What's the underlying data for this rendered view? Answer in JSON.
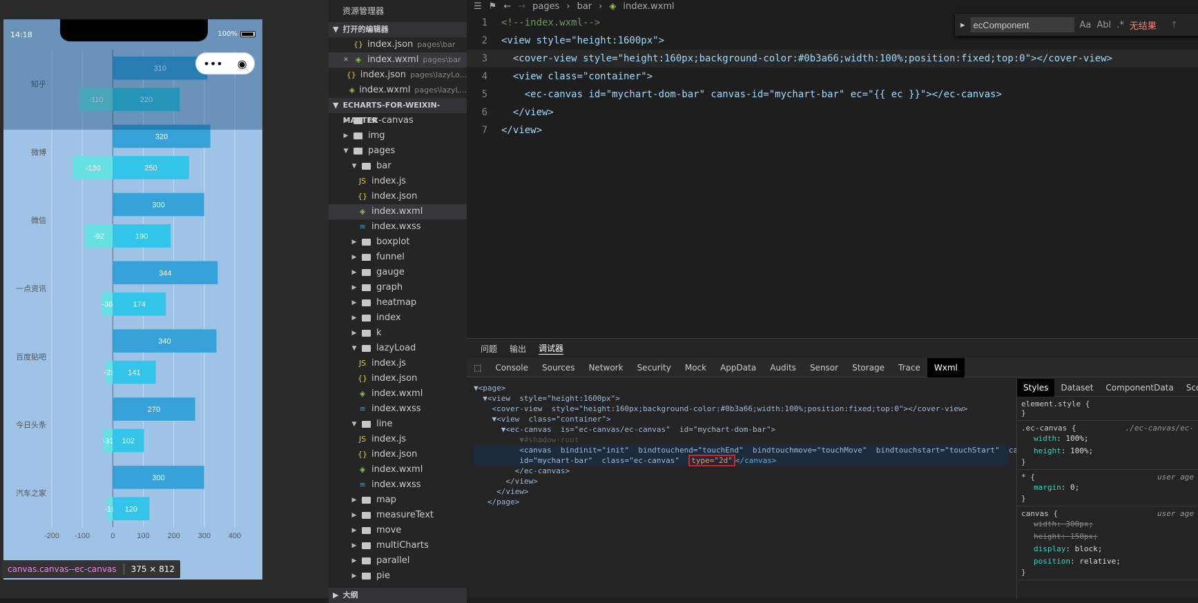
{
  "simulator": {
    "time": "14:18",
    "battery": "100%",
    "capsule_more": "•••",
    "capsule_close": "◉",
    "element_tag": "canvas.canvas--ec-canvas",
    "element_size": "375 × 812"
  },
  "chart_data": {
    "type": "bar",
    "orientation": "horizontal",
    "categories": [
      "知乎",
      "微博",
      "微信",
      "一点资讯",
      "百度贴吧",
      "今日头条",
      "汽车之家"
    ],
    "series": [
      {
        "values": [
          310,
          320,
          300,
          344,
          340,
          270,
          300
        ],
        "color": "#37a2da",
        "labels_shown": true
      },
      {
        "values": [
          220,
          250,
          190,
          174,
          141,
          102,
          120
        ],
        "color": "#32c5e9",
        "labels_shown": true
      },
      {
        "values": [
          -110,
          -130,
          -92,
          -36,
          -23,
          -31,
          -19
        ],
        "color": "#67e0e3",
        "labels_shown": true
      }
    ],
    "xlim": [
      -200,
      400
    ],
    "xticks": [
      "-200",
      "-100",
      "0",
      "100",
      "200",
      "300",
      "400"
    ],
    "grid": true,
    "background": "#9fc3e7"
  },
  "explorer": {
    "title": "资源管理器",
    "open_editors_label": "打开的编辑器",
    "open_editors": [
      {
        "name": "index.json",
        "path": "pages\\bar",
        "type": "json"
      },
      {
        "name": "index.wxml",
        "path": "pages\\bar",
        "type": "wxml",
        "close": "✕"
      },
      {
        "name": "index.json",
        "path": "pages\\lazyLo...",
        "type": "json"
      },
      {
        "name": "index.wxml",
        "path": "pages\\lazyL...",
        "type": "wxml"
      }
    ],
    "project_label": "ECHARTS-FOR-WEIXIN-MASTER",
    "tree": [
      {
        "name": "ec-canvas",
        "kind": "folder",
        "depth": 1
      },
      {
        "name": "img",
        "kind": "folder",
        "depth": 1
      },
      {
        "name": "pages",
        "kind": "folder",
        "depth": 1,
        "open": true
      },
      {
        "name": "bar",
        "kind": "folder",
        "depth": 2,
        "open": true
      },
      {
        "name": "index.js",
        "kind": "js",
        "depth": 3
      },
      {
        "name": "index.json",
        "kind": "json",
        "depth": 3
      },
      {
        "name": "index.wxml",
        "kind": "wxml",
        "depth": 3,
        "selected": true
      },
      {
        "name": "index.wxss",
        "kind": "wxss",
        "depth": 3
      },
      {
        "name": "boxplot",
        "kind": "folder",
        "depth": 2
      },
      {
        "name": "funnel",
        "kind": "folder",
        "depth": 2
      },
      {
        "name": "gauge",
        "kind": "folder",
        "depth": 2
      },
      {
        "name": "graph",
        "kind": "folder",
        "depth": 2
      },
      {
        "name": "heatmap",
        "kind": "folder",
        "depth": 2
      },
      {
        "name": "index",
        "kind": "folder",
        "depth": 2
      },
      {
        "name": "k",
        "kind": "folder",
        "depth": 2
      },
      {
        "name": "lazyLoad",
        "kind": "folder",
        "depth": 2,
        "open": true
      },
      {
        "name": "index.js",
        "kind": "js",
        "depth": 3
      },
      {
        "name": "index.json",
        "kind": "json",
        "depth": 3
      },
      {
        "name": "index.wxml",
        "kind": "wxml",
        "depth": 3
      },
      {
        "name": "index.wxss",
        "kind": "wxss",
        "depth": 3
      },
      {
        "name": "line",
        "kind": "folder",
        "depth": 2,
        "open": true
      },
      {
        "name": "index.js",
        "kind": "js",
        "depth": 3
      },
      {
        "name": "index.json",
        "kind": "json",
        "depth": 3
      },
      {
        "name": "index.wxml",
        "kind": "wxml",
        "depth": 3
      },
      {
        "name": "index.wxss",
        "kind": "wxss",
        "depth": 3
      },
      {
        "name": "map",
        "kind": "folder",
        "depth": 2
      },
      {
        "name": "measureText",
        "kind": "folder",
        "depth": 2
      },
      {
        "name": "move",
        "kind": "folder",
        "depth": 2
      },
      {
        "name": "multiCharts",
        "kind": "folder",
        "depth": 2
      },
      {
        "name": "parallel",
        "kind": "folder",
        "depth": 2
      },
      {
        "name": "pie",
        "kind": "folder",
        "depth": 2
      }
    ],
    "outline_label": "大纲"
  },
  "editor": {
    "breadcrumb": [
      "pages",
      "bar",
      "index.wxml"
    ],
    "find_query": "ecComponent",
    "find_no_result": "无结果",
    "find_opts": [
      "Aa",
      "Abl",
      ".*"
    ],
    "lines": [
      "<!--index.wxml-->",
      "<view style=\"height:1600px\">",
      "  <cover-view style=\"height:160px;background-color:#0b3a66;width:100%;position:fixed;top:0\"></cover-view>",
      "  <view class=\"container\">",
      "    <ec-canvas id=\"mychart-dom-bar\" canvas-id=\"mychart-bar\" ec=\"{{ ec }}\"></ec-canvas>",
      "  </view>",
      "</view>"
    ]
  },
  "devtools": {
    "top_tabs": [
      "问题",
      "输出",
      "调试器"
    ],
    "tabs": [
      "Console",
      "Sources",
      "Network",
      "Security",
      "Mock",
      "AppData",
      "Audits",
      "Sensor",
      "Storage",
      "Trace",
      "Wxml"
    ],
    "dom": [
      "▼<page>",
      "  ▼<view  style=\"height:1600px\">",
      "    <cover-view  style=\"height:160px;background-color:#0b3a66;width:100%;position:fixed;top:0\"></cover-view>",
      "    ▼<view  class=\"container\">",
      "      ▼<ec-canvas  is=\"ec-canvas/ec-canvas\"  id=\"mychart-dom-bar\">",
      "          ▼#shadow-root",
      "          <canvas  bindinit=\"init\"  bindtouchend=\"touchEnd\"  bindtouchmove=\"touchMove\"  bindtouchstart=\"touchStart\"  canva",
      "          id=\"mychart-bar\"  class=\"ec-canvas\"  ",
      "         </ec-canvas>",
      "       </view>",
      "     </view>",
      "   </page>"
    ],
    "dom_highlight": "type=\"2d\"",
    "dom_highlight_tail": "</canvas>",
    "style_tabs": [
      "Styles",
      "Dataset",
      "ComponentData",
      "Scop"
    ],
    "styles": [
      {
        "selector": "element.style {",
        "source": "",
        "props": [],
        "close": "}"
      },
      {
        "selector": ".ec-canvas {",
        "source": "./ec-canvas/ec-",
        "props": [
          {
            "n": "width",
            "v": "100%;"
          },
          {
            "n": "height",
            "v": "100%;"
          }
        ],
        "close": "}"
      },
      {
        "selector": "* {",
        "source": "user age",
        "props": [
          {
            "n": "margin",
            "v": "0;"
          }
        ],
        "close": "}"
      },
      {
        "selector": "canvas {",
        "source": "user age",
        "props": [
          {
            "n": "width",
            "v": "300px;",
            "strike": true
          },
          {
            "n": "height",
            "v": "150px;",
            "strike": true
          },
          {
            "n": "display",
            "v": "block;"
          },
          {
            "n": "position",
            "v": "relative;"
          }
        ],
        "close": "}"
      }
    ]
  }
}
